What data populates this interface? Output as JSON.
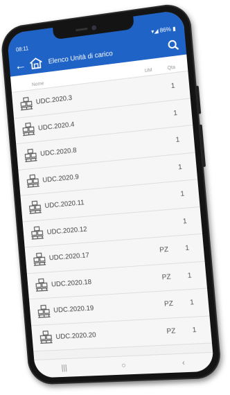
{
  "status_bar": {
    "time": "08:11",
    "battery": "86%"
  },
  "app_bar": {
    "title": "Elenco Unità di carico",
    "back_icon": "back-arrow-icon",
    "home_icon": "warehouse-home-icon",
    "search_icon": "search-icon"
  },
  "columns": {
    "name": "Nome",
    "um": "UM",
    "qty": "Qta"
  },
  "rows": [
    {
      "name": "UDC.2020.3",
      "um": "",
      "qty": "1"
    },
    {
      "name": "UDC.2020.4",
      "um": "",
      "qty": "1"
    },
    {
      "name": "UDC.2020.8",
      "um": "",
      "qty": "1"
    },
    {
      "name": "UDC.2020.9",
      "um": "",
      "qty": "1"
    },
    {
      "name": "UDC.2020.11",
      "um": "",
      "qty": "1"
    },
    {
      "name": "UDC.2020.12",
      "um": "",
      "qty": "1"
    },
    {
      "name": "UDC.2020.17",
      "um": "PZ",
      "qty": "1"
    },
    {
      "name": "UDC.2020.18",
      "um": "PZ",
      "qty": "1"
    },
    {
      "name": "UDC.2020.19",
      "um": "PZ",
      "qty": "1"
    },
    {
      "name": "UDC.2020.20",
      "um": "PZ",
      "qty": "1"
    }
  ],
  "nav": {
    "recent": "|||",
    "home": "○",
    "back": "‹"
  },
  "colors": {
    "accent": "#1f63c7"
  }
}
